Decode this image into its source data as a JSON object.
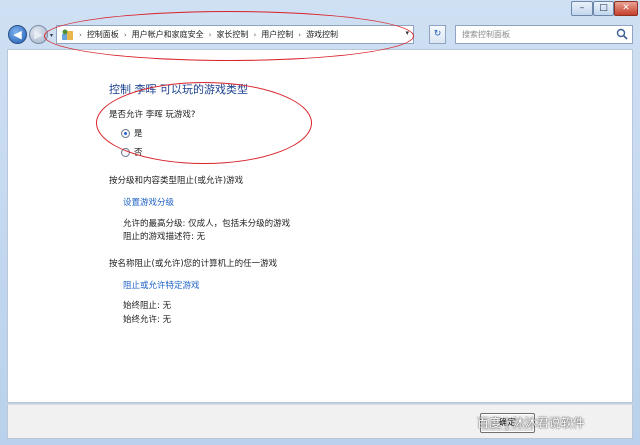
{
  "window": {
    "min_glyph": "–",
    "max_glyph": "□",
    "close_glyph": "✕"
  },
  "address_bar": {
    "breadcrumbs": [
      "控制面板",
      "用户帐户和家庭安全",
      "家长控制",
      "用户控制",
      "游戏控制"
    ],
    "separator": "›",
    "dropdown_glyph": "▾"
  },
  "nav": {
    "back_glyph": "◀",
    "forward_glyph": "▶",
    "refresh_glyph": "↻"
  },
  "search": {
    "placeholder": "搜索控制面板"
  },
  "main": {
    "title": "控制 李晖 可以玩的游戏类型",
    "question": "是否允许 李晖 玩游戏?",
    "options": [
      {
        "label": "是",
        "selected": true
      },
      {
        "label": "否",
        "selected": false
      }
    ],
    "rating_section": {
      "heading": "按分级和内容类型阻止(或允许)游戏",
      "link": "设置游戏分级",
      "max_rating": "允许的最高分级: 仅成人，包括未分级的游戏",
      "blocked_descriptors": "阻止的游戏描述符: 无"
    },
    "name_section": {
      "heading": "按名称阻止(或允许)您的计算机上的任一游戏",
      "link": "阻止或允许特定游戏",
      "always_block": "始终阻止: 无",
      "always_allow": "始终允许: 无"
    }
  },
  "footer": {
    "ok_label": "确定",
    "watermark": "百度 | 沐沐君说软件"
  },
  "colors": {
    "link": "#1e62c5",
    "title": "#1a3f8c",
    "annotation": "#d9242b"
  }
}
